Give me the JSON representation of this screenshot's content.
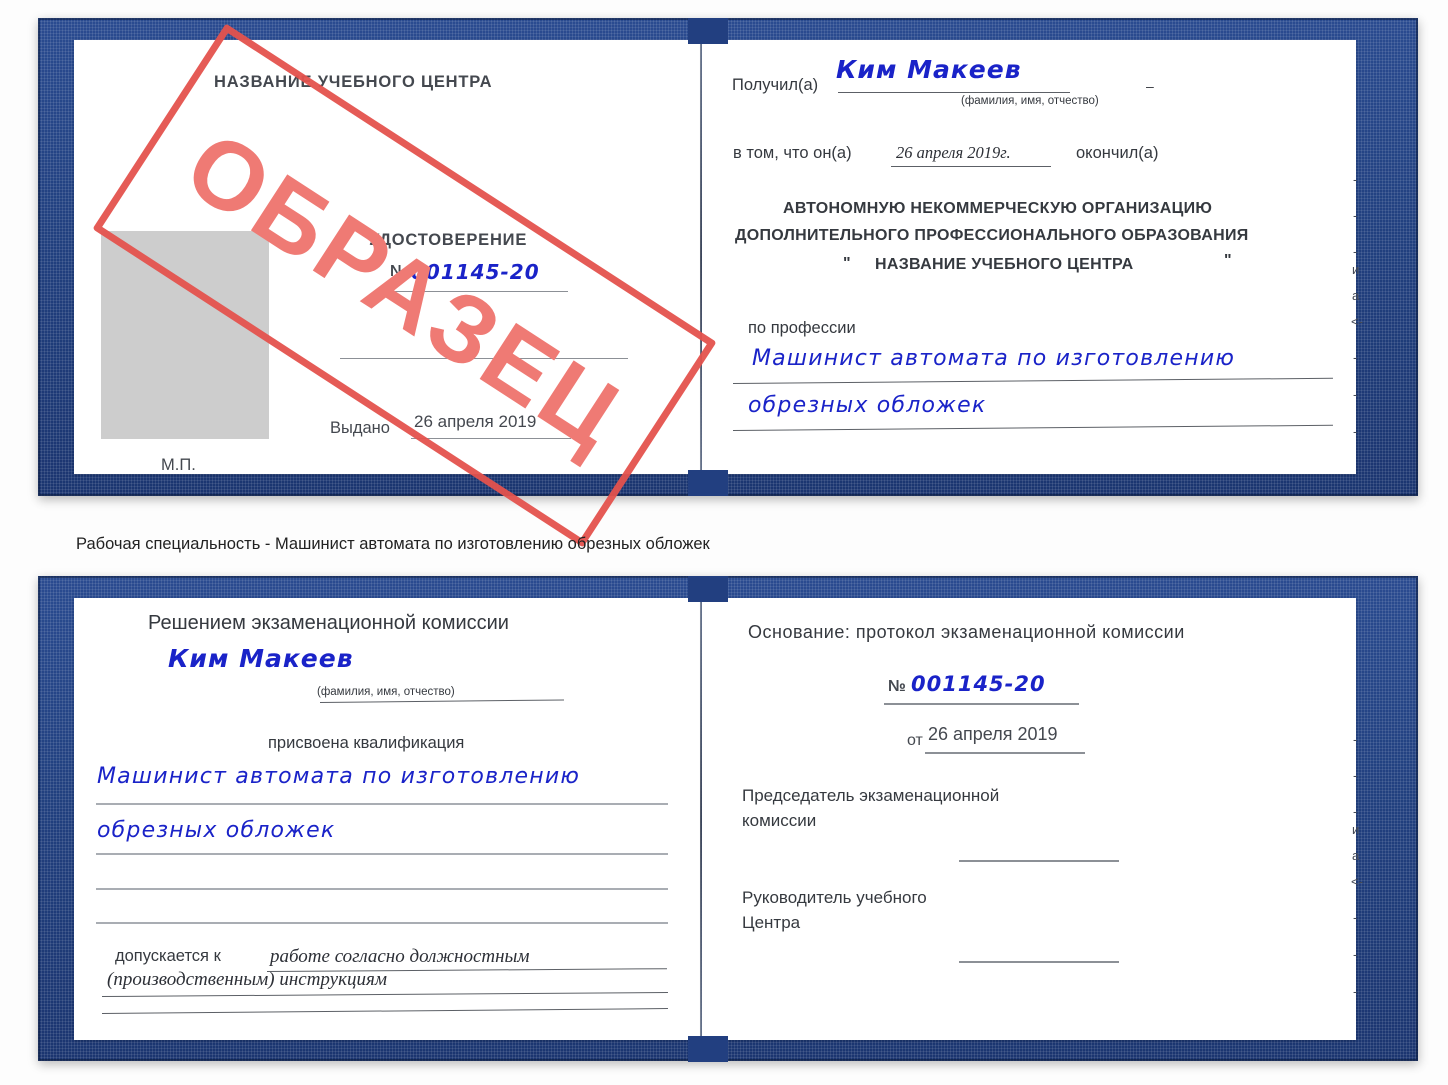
{
  "caption": "Рабочая специальность - Машинист автомата по изготовлению обрезных обложек",
  "doc1": {
    "left_page": {
      "header": "НАЗВАНИЕ УЧЕБНОГО ЦЕНТРА",
      "title": "УДОСТОВЕРЕНИЕ",
      "number_label": "№",
      "number_value": "001145-20",
      "issued_label": "Выдано",
      "issued_value": "26 апреля 2019",
      "seal_label": "М.П."
    },
    "right_page": {
      "received_label": "Получил(а)",
      "received_value": "Ким Макеев",
      "fio_hint": "(фамилия, имя, отчество)",
      "that_he_label": "в том, что он(а)",
      "completion_date": "26 апреля 2019г.",
      "finished_label": "окончил(а)",
      "org_line1": "АВТОНОМНУЮ НЕКОММЕРЧЕСКУЮ ОРГАНИЗАЦИЮ",
      "org_line2": "ДОПОЛНИТЕЛЬНОГО ПРОФЕССИОНАЛЬНОГО ОБРАЗОВАНИЯ",
      "org_quote_open": "\"",
      "org_line3": "НАЗВАНИЕ УЧЕБНОГО ЦЕНТРА",
      "org_quote_close": "\"",
      "profession_label": "по профессии",
      "profession_value_line1": "Машинист автомата по изготовлению",
      "profession_value_line2": "обрезных обложек"
    },
    "edge_fragments": [
      "-",
      "-",
      "-",
      "и",
      "а",
      "<-",
      "-",
      "-",
      "-"
    ]
  },
  "doc2": {
    "left_page": {
      "header": "Решением экзаменационной комиссии",
      "name_value": "Ким Макеев",
      "fio_hint": "(фамилия, имя, отчество)",
      "qualification_label": "присвоена квалификация",
      "qualification_line1": "Машинист автомата по изготовлению",
      "qualification_line2": "обрезных обложек",
      "allowed_label": "допускается к",
      "allowed_value_line1": "работе согласно должностным",
      "allowed_value_line2": "(производственным) инструкциям"
    },
    "right_page": {
      "basis_label": "Основание: протокол экзаменационной комиссии",
      "number_label": "№",
      "number_value": "001145-20",
      "from_label": "от",
      "from_value": "26 апреля 2019",
      "chairman_line1": "Председатель экзаменационной",
      "chairman_line2": "комиссии",
      "head_line1": "Руководитель учебного",
      "head_line2": "Центра"
    },
    "edge_fragments": [
      "-",
      "-",
      "-",
      "и",
      "а",
      "<-",
      "-",
      "-",
      "-"
    ]
  },
  "stamp": {
    "text": "ОБРАЗЕЦ",
    "border_color": "#e4524d",
    "text_color": "#ef7a74",
    "angle_deg": 33
  },
  "colors": {
    "cover_blue": "#21407f",
    "handwriting_blue": "#1a23c8",
    "page_white": "#ffffff",
    "photo_gray": "#cdcdcd"
  }
}
